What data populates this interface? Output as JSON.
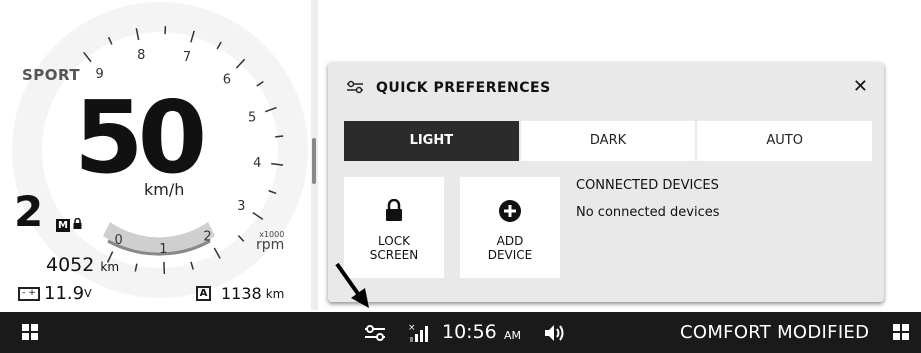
{
  "cluster": {
    "drive_mode": "SPORT",
    "speed": "50",
    "speed_unit": "km/h",
    "gear": "2",
    "gear_mode_badge": "M",
    "lock_icon": "lock-icon",
    "rpm_ticks": [
      "0",
      "1",
      "2",
      "3",
      "4",
      "5",
      "6",
      "7",
      "8",
      "9"
    ],
    "rpm_multiplier": "x1000",
    "rpm_unit": "rpm",
    "odometer": "4052",
    "odometer_unit": "km",
    "battery_voltage": "11.9",
    "battery_unit": "V",
    "trip_badge": "A",
    "trip_value": "1138",
    "trip_unit": "km"
  },
  "quick_preferences": {
    "title": "QUICK PREFERENCES",
    "icon": "preferences-toggle-icon",
    "close_icon": "close-icon",
    "close_label": "✕",
    "theme_options": [
      {
        "label": "LIGHT",
        "active": true
      },
      {
        "label": "DARK",
        "active": false
      },
      {
        "label": "AUTO",
        "active": false
      }
    ],
    "lock_screen": {
      "line1": "LOCK",
      "line2": "SCREEN",
      "icon": "lock-icon"
    },
    "add_device": {
      "line1": "ADD",
      "line2": "DEVICE",
      "icon": "plus-circle-icon"
    },
    "connected_devices_title": "CONNECTED DEVICES",
    "connected_devices_status": "No connected devices"
  },
  "bottom_bar": {
    "left_icon": "grid-icon",
    "prefs_icon": "preferences-toggle-icon",
    "signal_icon": "no-signal-icon",
    "time": "10:56",
    "ampm": "AM",
    "volume_icon": "volume-icon",
    "ride_mode": "COMFORT MODIFIED",
    "right_icon": "grid-icon"
  },
  "colors": {
    "panel_bg": "#e9e9e9",
    "active_button": "#2b2b2b",
    "bottom_bar": "#1a1a1a"
  }
}
